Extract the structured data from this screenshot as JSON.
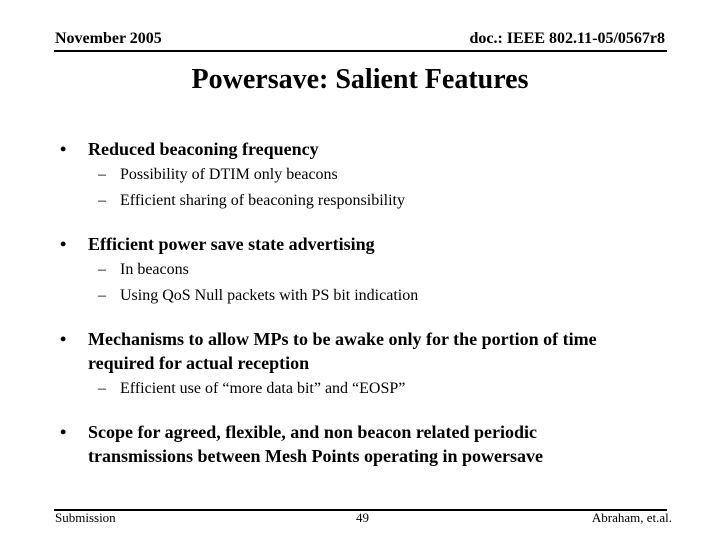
{
  "header": {
    "date": "November 2005",
    "doc_id": "doc.: IEEE 802.11-05/0567r8"
  },
  "title": "Powersave: Salient Features",
  "bullets": [
    {
      "text": "Reduced beaconing frequency",
      "sub": [
        "Possibility of DTIM only beacons",
        "Efficient sharing of beaconing responsibility"
      ]
    },
    {
      "text": "Efficient power save state advertising",
      "sub": [
        "In beacons",
        "Using QoS Null packets with PS bit indication"
      ]
    },
    {
      "text_line1": "Mechanisms to allow MPs to be awake only for the portion of time",
      "text_line2": "required for actual reception",
      "sub": [
        "Efficient use of “more data bit” and “EOSP”"
      ]
    },
    {
      "text_line1": "Scope for agreed, flexible, and non beacon related periodic",
      "text_line2": "transmissions between Mesh Points operating in powersave"
    }
  ],
  "bullet_glyph": "•",
  "dash_glyph": "–",
  "footer": {
    "left": "Submission",
    "page": "49",
    "right": "Abraham, et.al."
  }
}
